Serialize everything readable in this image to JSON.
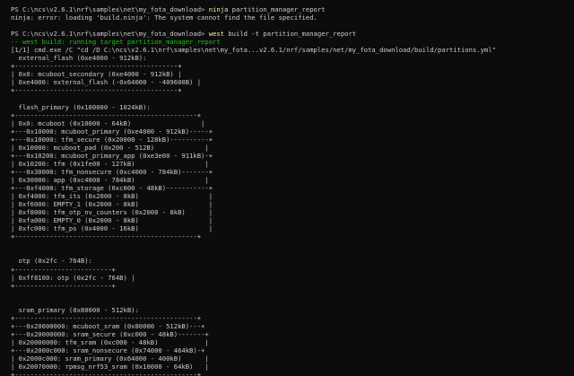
{
  "colors": {
    "background": "#0c0c0c",
    "default": "#cccccc",
    "cmd": "#f9f1a5",
    "green": "#16c60c"
  },
  "lines": [
    [
      {
        "t": "PS C:\\ncs\\v2.6.1\\nrf\\samples\\net\\my_fota_download> ",
        "c": "default"
      },
      {
        "t": "ninja",
        "c": "cmd"
      },
      {
        "t": " partition_manager_report",
        "c": "default"
      }
    ],
    [
      {
        "t": "ninja: error: loading 'build.ninja': The system cannot find the file specified.",
        "c": "default"
      }
    ],
    [
      {
        "t": "",
        "c": "default"
      }
    ],
    [
      {
        "t": "PS C:\\ncs\\v2.6.1\\nrf\\samples\\net\\my_fota_download> ",
        "c": "default"
      },
      {
        "t": "west",
        "c": "cmd"
      },
      {
        "t": " build -t partition_manager_report",
        "c": "default"
      }
    ],
    [
      {
        "t": "-- west build: running target partition_manager_report",
        "c": "green"
      }
    ],
    [
      {
        "t": "[1/1] cmd.exe /C \"cd /D C:\\ncs\\v2.6.1\\nrf\\samples\\net\\my_fota...v2.6.1/nrf/samples/net/my_fota_download/build/partitions.yml\"",
        "c": "default"
      }
    ],
    [
      {
        "t": "  external_flash (0xe4000 - 912kB):",
        "c": "default"
      }
    ],
    [
      {
        "t": "+------------------------------------------+",
        "c": "default"
      }
    ],
    [
      {
        "t": "| 0x0: mcuboot_secondary (0xe4000 - 912kB) |",
        "c": "default"
      }
    ],
    [
      {
        "t": "| 0xe4000: external_flash (-0x64000 - -409600B) |",
        "c": "default"
      }
    ],
    [
      {
        "t": "+------------------------------------------+",
        "c": "default"
      }
    ],
    [
      {
        "t": "",
        "c": "default"
      }
    ],
    [
      {
        "t": "  flash_primary (0x100000 - 1024kB):",
        "c": "default"
      }
    ],
    [
      {
        "t": "+-----------------------------------------------+",
        "c": "default"
      }
    ],
    [
      {
        "t": "| 0x0: mcuboot (0x10000 - 64kB)                  |",
        "c": "default"
      }
    ],
    [
      {
        "t": "+---0x10000: mcuboot_primary (0xe4000 - 912kB)-----+",
        "c": "default"
      }
    ],
    [
      {
        "t": "+---0x10000: tfm_secure (0x20000 - 128kB)----------+",
        "c": "default"
      }
    ],
    [
      {
        "t": "| 0x10000: mcuboot_pad (0x200 - 512B)             |",
        "c": "default"
      }
    ],
    [
      {
        "t": "+---0x10200: mcuboot_primary_app (0xe3e00 - 911kB)-+",
        "c": "default"
      }
    ],
    [
      {
        "t": "| 0x10200: tfm (0x1fe00 - 127kB)                  |",
        "c": "default"
      }
    ],
    [
      {
        "t": "+---0x30000: tfm_nonsecure (0xc4000 - 784kB)-------+",
        "c": "default"
      }
    ],
    [
      {
        "t": "| 0x30000: app (0xc4000 - 784kB)                  |",
        "c": "default"
      }
    ],
    [
      {
        "t": "+---0xf4000: tfm_storage (0xc000 - 48kB)-----------+",
        "c": "default"
      }
    ],
    [
      {
        "t": "| 0xf4000: tfm_its (0x2000 - 8kB)                  |",
        "c": "default"
      }
    ],
    [
      {
        "t": "| 0xf6000: EMPTY_1 (0x2000 - 8kB)                  |",
        "c": "default"
      }
    ],
    [
      {
        "t": "| 0xf8000: tfm_otp_nv_counters (0x2000 - 8kB)      |",
        "c": "default"
      }
    ],
    [
      {
        "t": "| 0xfa000: EMPTY_0 (0x2000 - 8kB)                  |",
        "c": "default"
      }
    ],
    [
      {
        "t": "| 0xfc000: tfm_ps (0x4000 - 16kB)                  |",
        "c": "default"
      }
    ],
    [
      {
        "t": "+-----------------------------------------------+",
        "c": "default"
      }
    ],
    [
      {
        "t": "",
        "c": "default"
      }
    ],
    [
      {
        "t": "",
        "c": "default"
      }
    ],
    [
      {
        "t": "  otp (0x2fc - 764B):",
        "c": "default"
      }
    ],
    [
      {
        "t": "+-------------------------+",
        "c": "default"
      }
    ],
    [
      {
        "t": "| 0xff8100: otp (0x2fc - 764B) |",
        "c": "default"
      }
    ],
    [
      {
        "t": "+-------------------------+",
        "c": "default"
      }
    ],
    [
      {
        "t": "",
        "c": "default"
      }
    ],
    [
      {
        "t": "",
        "c": "default"
      }
    ],
    [
      {
        "t": "  sram_primary (0x80000 - 512kB):",
        "c": "default"
      }
    ],
    [
      {
        "t": "+-----------------------------------------------+",
        "c": "default"
      }
    ],
    [
      {
        "t": "+---0x20000000: mcuboot_sram (0x80000 - 512kB)---+",
        "c": "default"
      }
    ],
    [
      {
        "t": "+---0x20000000: sram_secure (0xc000 - 48kB)-------+",
        "c": "default"
      }
    ],
    [
      {
        "t": "| 0x20000000: tfm_sram (0xc000 - 48kB)            |",
        "c": "default"
      }
    ],
    [
      {
        "t": "+---0x2000c000: sram_nonsecure (0x74000 - 464kB)-+",
        "c": "default"
      }
    ],
    [
      {
        "t": "| 0x2000c000: sram_primary (0x64000 - 400kB)      |",
        "c": "default"
      }
    ],
    [
      {
        "t": "| 0x20070000: rpmsg_nrf53_sram (0x10000 - 64kB)   |",
        "c": "default"
      }
    ],
    [
      {
        "t": "+-----------------------------------------------+",
        "c": "default"
      }
    ]
  ]
}
